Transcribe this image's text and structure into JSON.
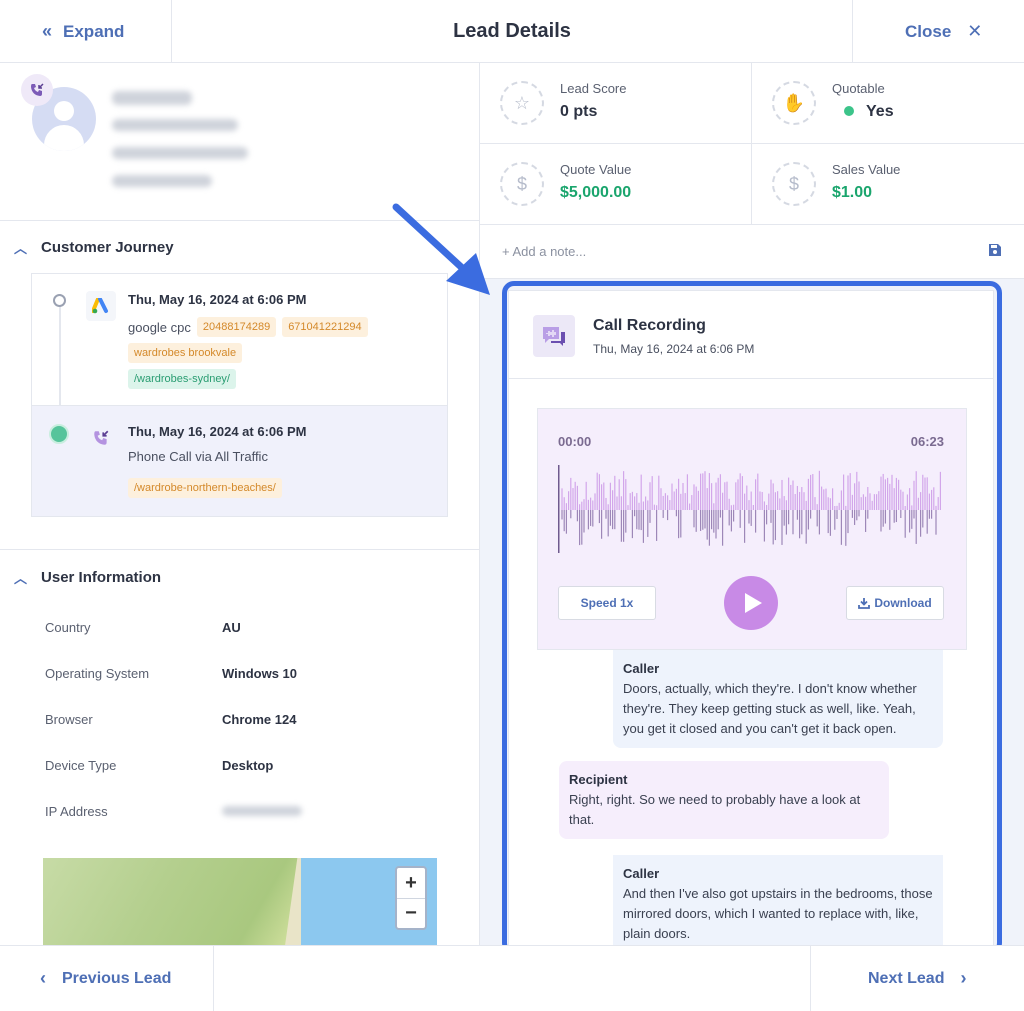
{
  "header": {
    "expand_label": "Expand",
    "title": "Lead Details",
    "close_label": "Close"
  },
  "customer_journey": {
    "title": "Customer Journey",
    "items": [
      {
        "date": "Thu, May 16, 2024 at 6:06 PM",
        "source": "google cpc",
        "tags": [
          "20488174289",
          "671041221294",
          "wardrobes brookvale"
        ],
        "landing": "/wardrobes-sydney/",
        "icon": "google-ads-icon"
      },
      {
        "date": "Thu, May 16, 2024 at 6:06 PM",
        "source": "Phone Call via All Traffic",
        "landing": "/wardrobe-northern-beaches/",
        "icon": "phone-call-icon"
      }
    ]
  },
  "user_information": {
    "title": "User Information",
    "rows": [
      {
        "key": "Country",
        "value": "AU"
      },
      {
        "key": "Operating System",
        "value": "Windows 10"
      },
      {
        "key": "Browser",
        "value": "Chrome 124"
      },
      {
        "key": "Device Type",
        "value": "Desktop"
      },
      {
        "key": "IP Address",
        "value": ""
      }
    ],
    "map": {
      "zoom_in": "+",
      "zoom_out": "−"
    }
  },
  "stats": {
    "lead_score_label": "Lead Score",
    "lead_score_value": "0 pts",
    "quotable_label": "Quotable",
    "quotable_value": "Yes",
    "quote_value_label": "Quote Value",
    "quote_value": "$5,000.00",
    "sales_value_label": "Sales Value",
    "sales_value": "$1.00"
  },
  "note": {
    "placeholder": "+ Add a note..."
  },
  "call_recording": {
    "title": "Call Recording",
    "date": "Thu, May 16, 2024 at 6:06 PM",
    "time_start": "00:00",
    "time_end": "06:23",
    "speed_label": "Speed 1x",
    "download_label": "Download",
    "transcript": [
      {
        "speaker": "Caller",
        "text": "Doors, actually, which they're. I don't know whether they're. They keep getting stuck as well, like. Yeah, you get it closed and you can't get it back open."
      },
      {
        "speaker": "Recipient",
        "text": "Right, right. So we need to probably have a look at that."
      },
      {
        "speaker": "Caller",
        "text": "And then I've also got upstairs in the bedrooms, those mirrored doors, which I wanted to replace with, like, plain doors."
      }
    ]
  },
  "footer": {
    "prev_label": "Previous Lead",
    "next_label": "Next Lead"
  },
  "colors": {
    "accent": "#4e6fb5",
    "highlight": "#3b6ce0",
    "positive": "#1aa56d",
    "player_bg": "#f5eefc"
  }
}
